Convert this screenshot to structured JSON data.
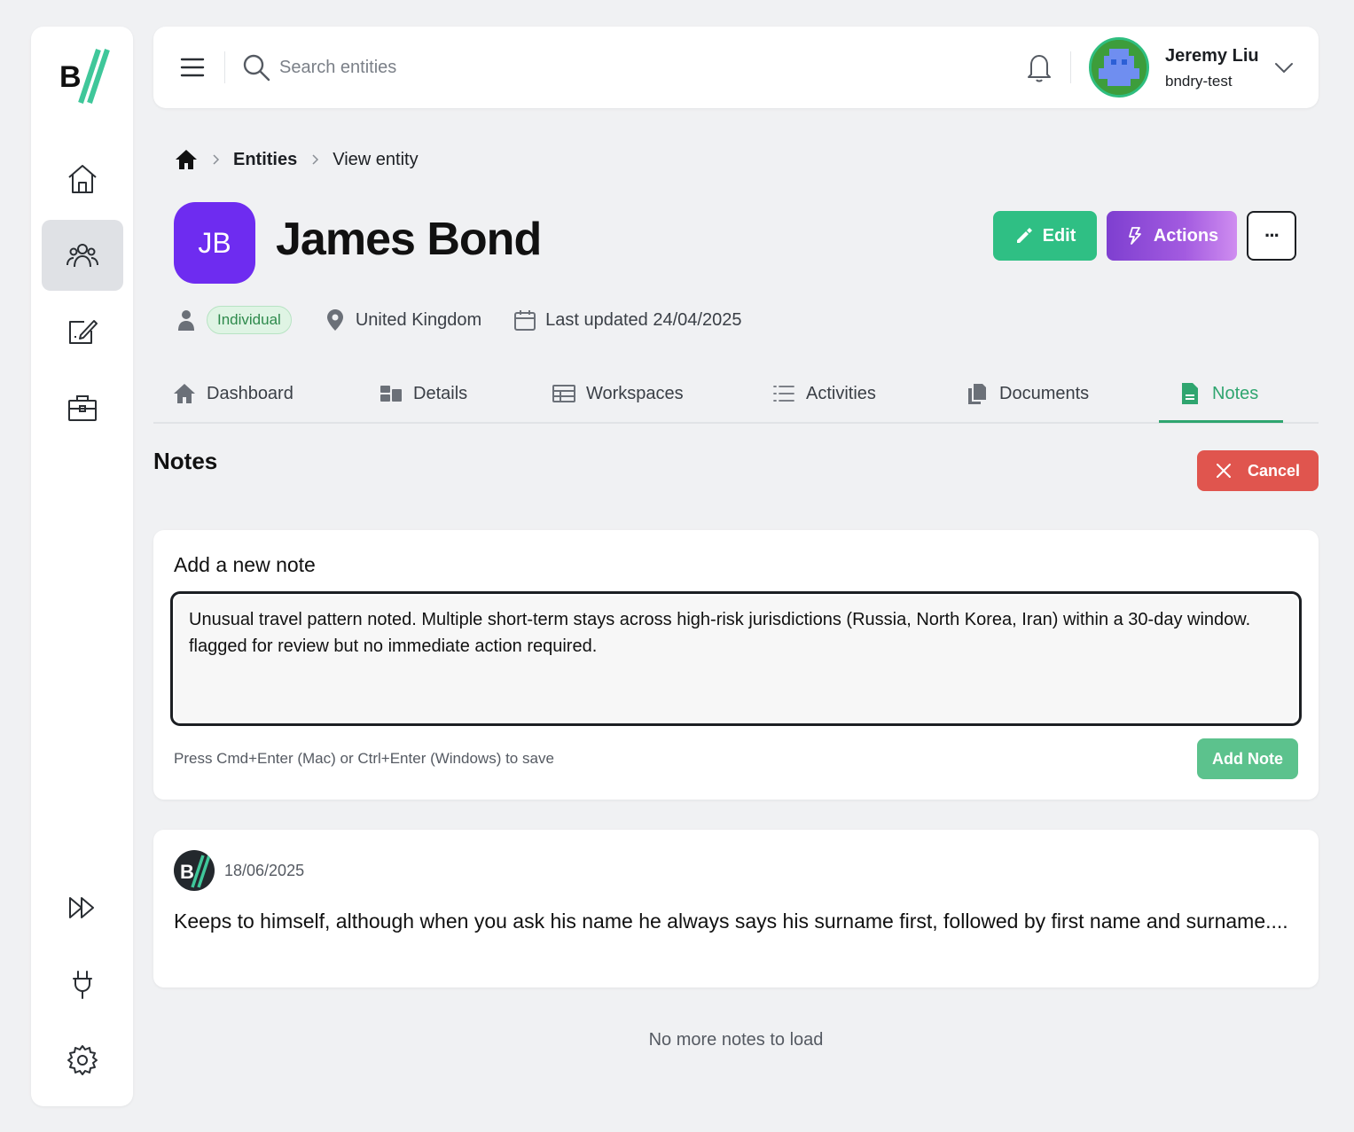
{
  "sidebar": {
    "items": [
      {
        "icon": "home-icon"
      },
      {
        "icon": "users-icon",
        "active": true
      },
      {
        "icon": "edit-note-icon"
      },
      {
        "icon": "briefcase-icon"
      },
      {
        "icon": "fast-forward-icon"
      },
      {
        "icon": "plug-icon"
      },
      {
        "icon": "gear-icon"
      }
    ]
  },
  "topbar": {
    "search_placeholder": "Search entities",
    "user": {
      "name": "Jeremy Liu",
      "org": "bndry-test"
    }
  },
  "breadcrumb": {
    "link": "Entities",
    "current": "View entity"
  },
  "entity": {
    "initials": "JB",
    "name": "James Bond",
    "type_badge": "Individual",
    "country": "United Kingdom",
    "last_updated": "Last updated 24/04/2025",
    "colors": {
      "avatar": "#6e2cf0",
      "badge_bg": "#dff4e4",
      "badge_text": "#2e8a4c"
    }
  },
  "actions": {
    "edit_label": "Edit",
    "actions_label": "Actions",
    "more_label": "···"
  },
  "tabs": [
    {
      "label": "Dashboard",
      "icon": "home-icon"
    },
    {
      "label": "Details",
      "icon": "details-icon"
    },
    {
      "label": "Workspaces",
      "icon": "table-icon"
    },
    {
      "label": "Activities",
      "icon": "list-icon"
    },
    {
      "label": "Documents",
      "icon": "documents-icon"
    },
    {
      "label": "Notes",
      "icon": "note-icon",
      "active": true
    }
  ],
  "notes": {
    "title": "Notes",
    "cancel_label": "Cancel",
    "new_note": {
      "title": "Add a new note",
      "value": "Unusual travel pattern noted. Multiple short-term stays across high-risk jurisdictions (Russia, North Korea, Iran) within a 30-day window. flagged for review but no immediate action required.",
      "hint": "Press Cmd+Enter (Mac) or Ctrl+Enter (Windows) to save",
      "add_label": "Add Note"
    },
    "items": [
      {
        "date": "18/06/2025",
        "body": "Keeps to himself, although when you ask his name he always says his surname first, followed by first name and surname...."
      }
    ],
    "end_text": "No more notes to load"
  },
  "colors": {
    "accent_green": "#2fbf84",
    "danger": "#e0554e",
    "active_tab": "#2fa56f"
  }
}
